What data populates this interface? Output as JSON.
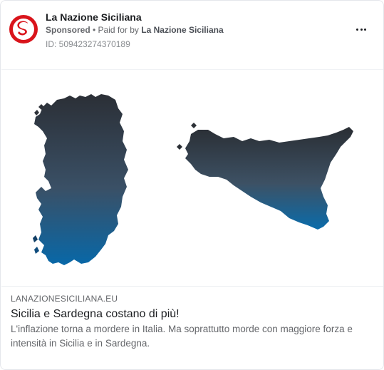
{
  "header": {
    "page_name": "La Nazione Siciliana",
    "sponsored_label": "Sponsored",
    "separator": " • ",
    "paid_for_prefix": "Paid for by",
    "advertiser": "La Nazione Siciliana",
    "ad_id": "ID: 509423274370189",
    "more_icon": "more-horizontal-icon"
  },
  "image": {
    "description_icon": "map-sardinia-sicily",
    "gradient_top": "#242a33",
    "gradient_bottom": "#0b6aa8"
  },
  "link": {
    "domain": "LANAZIONESICILIANA.EU",
    "headline": "Sicilia e Sardegna costano di più!",
    "description": "L'inflazione torna a mordere in Italia. Ma soprattutto morde con maggiore forza e intensità in Sicilia e in Sardegna."
  },
  "colors": {
    "logo_red": "#d9141b",
    "text_primary": "#1c1e21",
    "text_secondary": "#65676b"
  }
}
